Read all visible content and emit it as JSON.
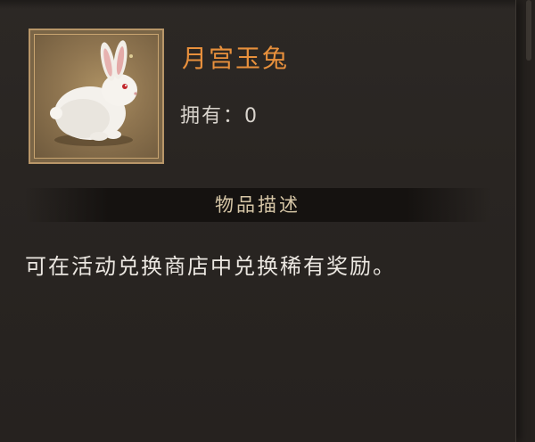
{
  "item": {
    "name": "月宫玉兔",
    "owned_text": "拥有：0",
    "icon": "white-rabbit"
  },
  "section": {
    "title": "物品描述"
  },
  "description": {
    "text": "可在活动兑换商店中兑换稀有奖励。"
  },
  "colors": {
    "item_name": "#e8903c",
    "frame_gold": "#b89668",
    "panel_bg": "#2a2623",
    "text_light": "#ebe7e1"
  }
}
